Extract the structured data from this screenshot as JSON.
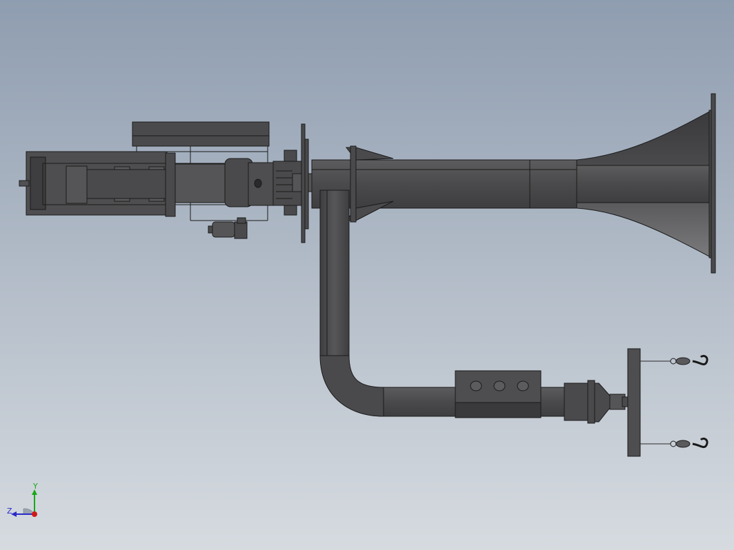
{
  "viewport": {
    "background_top": "#8f9db0",
    "background_bottom": "#d6dbe0",
    "model_color": "#4a4a4c",
    "edge_color": "#1a1a1a"
  },
  "triad": {
    "y_label": "Y",
    "z_label": "Z",
    "y_color": "#18a818",
    "z_color": "#2a2ac8",
    "x_color": "#d01818"
  },
  "model": {
    "parts": [
      "arm-assembly",
      "wheel-disc",
      "main-tube",
      "flared-horn",
      "vertical-post",
      "elbow-pipe",
      "bolt-block",
      "nozzle",
      "hook-plate",
      "hook"
    ]
  }
}
